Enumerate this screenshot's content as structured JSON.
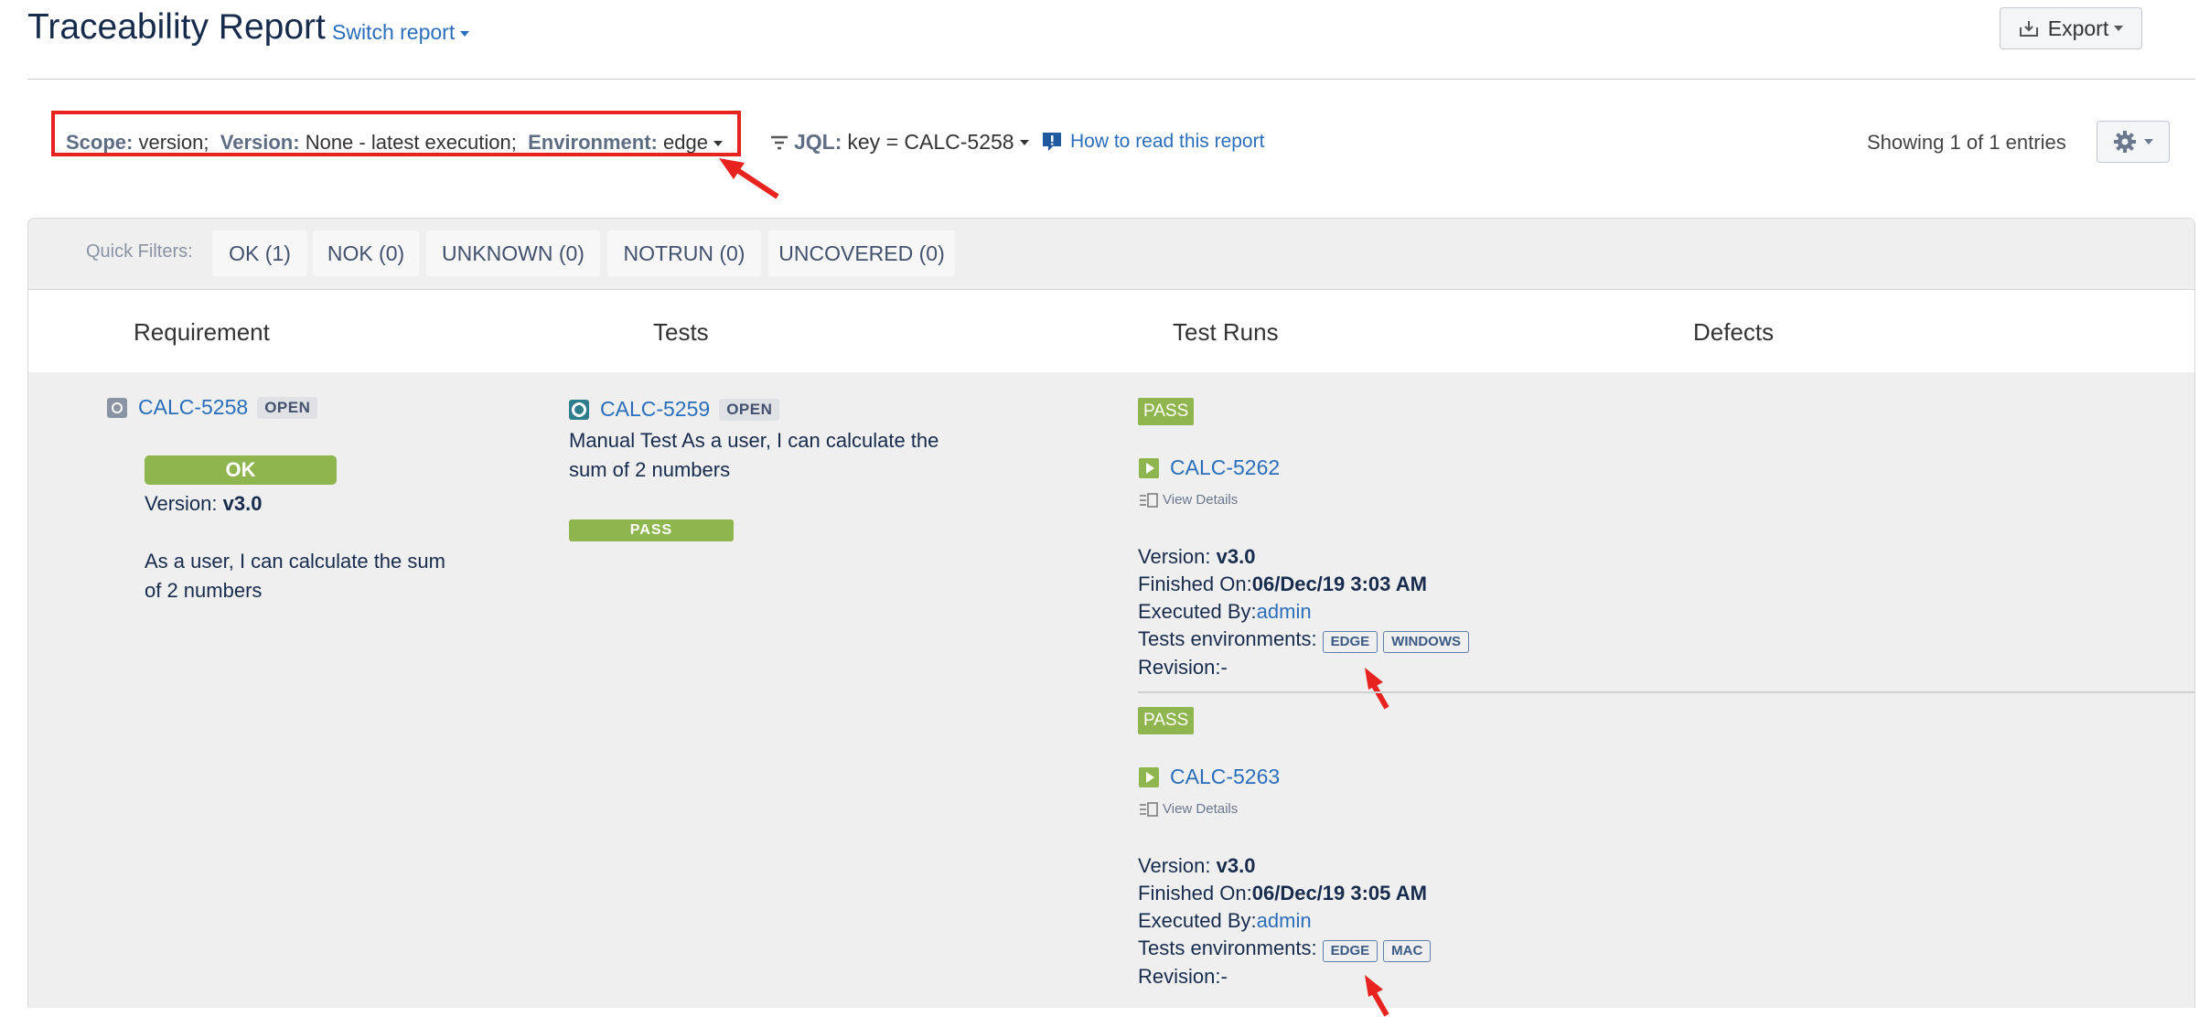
{
  "header": {
    "title": "Traceability Report",
    "switch_report": "Switch report",
    "export": "Export"
  },
  "filter": {
    "scope_label": "Scope:",
    "scope_value": "version;",
    "version_label": "Version:",
    "version_value": "None - latest execution;",
    "environment_label": "Environment:",
    "environment_value": "edge",
    "jql_label": "JQL:",
    "jql_value": "key = CALC-5258",
    "how_to": "How to read this report",
    "showing": "Showing 1 of 1 entries"
  },
  "quick_filters": {
    "label": "Quick Filters:",
    "items": [
      "OK (1)",
      "NOK (0)",
      "UNKNOWN (0)",
      "NOTRUN (0)",
      "UNCOVERED (0)"
    ]
  },
  "columns": [
    "Requirement",
    "Tests",
    "Test Runs",
    "Defects"
  ],
  "requirement": {
    "key": "CALC-5258",
    "status": "OPEN",
    "result": "OK",
    "version_label": "Version:",
    "version": "v3.0",
    "summary_line1": "As a user, I can calculate the sum",
    "summary_line2": "of 2 numbers"
  },
  "test": {
    "key": "CALC-5259",
    "status": "OPEN",
    "summary_line1": "Manual Test As a user, I can calculate the",
    "summary_line2": "sum of 2 numbers",
    "result": "PASS"
  },
  "runs": [
    {
      "status": "PASS",
      "key": "CALC-5262",
      "view_details": "View Details",
      "version_label": "Version:",
      "version": "v3.0",
      "finished_label": "Finished On:",
      "finished": "06/Dec/19 3:03 AM",
      "executed_label": "Executed By:",
      "executed_by": "admin",
      "env_label": "Tests environments:",
      "envs": [
        "EDGE",
        "WINDOWS"
      ],
      "revision": "Revision:-"
    },
    {
      "status": "PASS",
      "key": "CALC-5263",
      "view_details": "View Details",
      "version_label": "Version:",
      "version": "v3.0",
      "finished_label": "Finished On:",
      "finished": "06/Dec/19 3:05 AM",
      "executed_label": "Executed By:",
      "executed_by": "admin",
      "env_label": "Tests environments:",
      "envs": [
        "EDGE",
        "MAC"
      ],
      "revision": "Revision:-"
    }
  ],
  "colors": {
    "link": "#2a6ebb",
    "pass": "#8fb54e",
    "annotation": "#e8231f"
  }
}
